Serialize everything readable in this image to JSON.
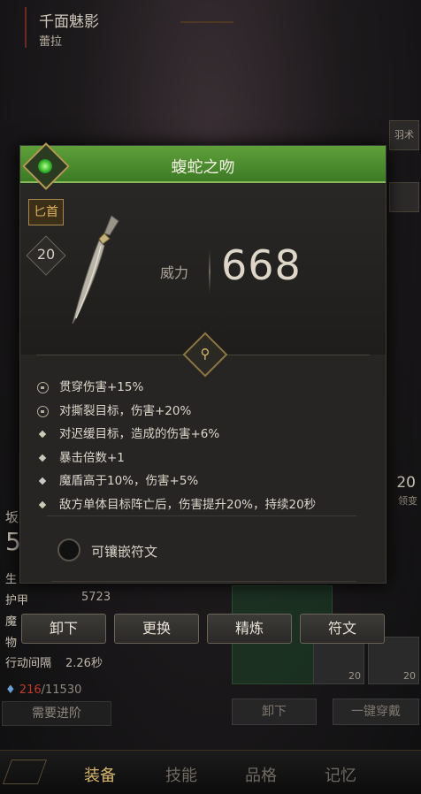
{
  "header": {
    "title": "千面魅影",
    "subtitle": "蕾拉"
  },
  "stats": [
    {
      "label": "护甲",
      "value": "5723"
    },
    {
      "label": "行动间隔",
      "value": "2.26秒"
    }
  ],
  "stats_partial_labels": [
    "生",
    "魔",
    "物"
  ],
  "left_partial": {
    "label": "坂",
    "number": "5"
  },
  "mp": {
    "current": "216",
    "max": "/11530"
  },
  "need_advance": "需要进阶",
  "bottom_buttons": {
    "unequip": "卸下",
    "one_click_wear": "一键穿戴"
  },
  "tabs": [
    "装备",
    "技能",
    "品格",
    "记忆"
  ],
  "side": {
    "label_top": "羽术",
    "number": "20",
    "label_bottom": "领变"
  },
  "slot_numbers": [
    "20",
    "20",
    "20"
  ],
  "item": {
    "name": "蝮蛇之吻",
    "type": "匕首",
    "level": "20",
    "power_label": "威力",
    "power_value": "668"
  },
  "attributes": [
    {
      "icon": "lock",
      "text": "贯穿伤害+15%"
    },
    {
      "icon": "lock",
      "text": "对撕裂目标，伤害+20%"
    },
    {
      "icon": "dot",
      "text": "对迟缓目标，造成的伤害+6%"
    },
    {
      "icon": "dot",
      "text": "暴击倍数+1"
    },
    {
      "icon": "dot",
      "text": "魔盾高于10%，伤害+5%"
    },
    {
      "icon": "dot",
      "text": "敌方单体目标阵亡后，伤害提升20%，持续20秒"
    }
  ],
  "rune_socket_label": "可镶嵌符文",
  "actions": {
    "unequip": "卸下",
    "replace": "更换",
    "refine": "精炼",
    "rune": "符文"
  },
  "colors": {
    "title_green": "#4a8c2e",
    "accent_gold": "#d7b56d",
    "mp_red": "#c0392b"
  }
}
